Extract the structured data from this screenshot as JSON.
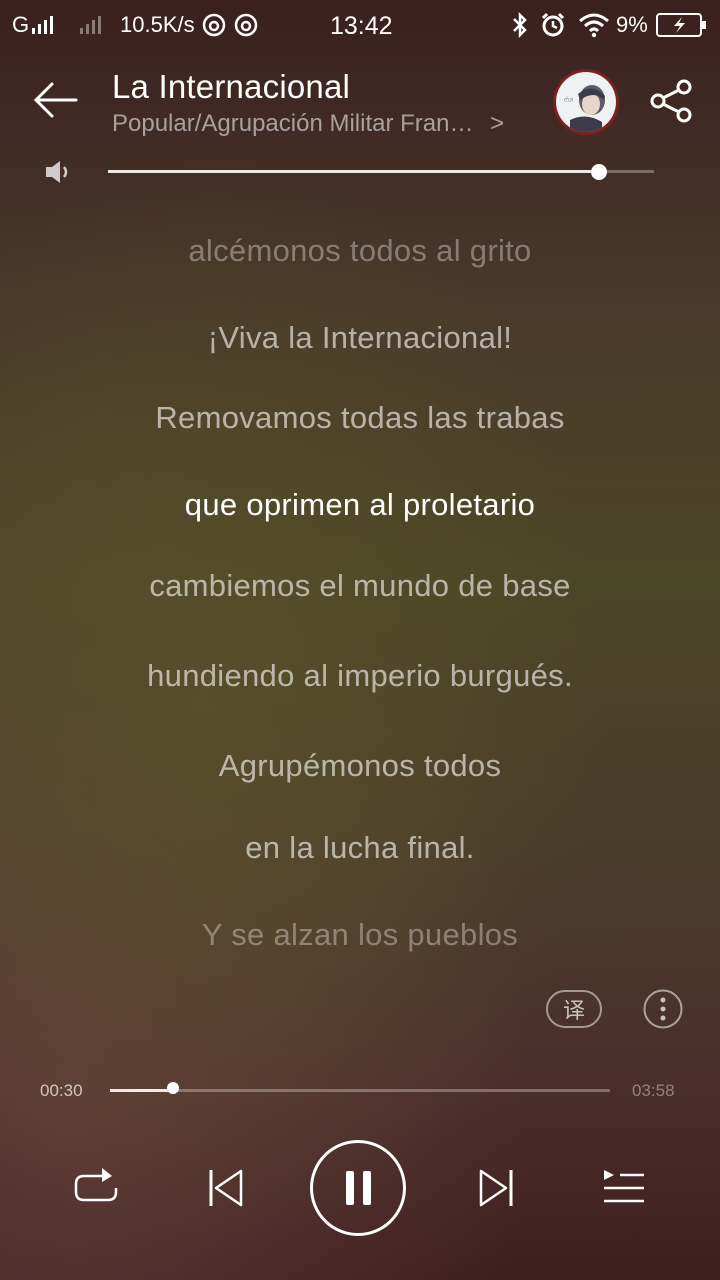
{
  "status_bar": {
    "network": "G",
    "speed": "10.5K/s",
    "time": "13:42",
    "battery": "9%"
  },
  "header": {
    "title": "La Internacional",
    "subtitle": "Popular/Agrupación Militar Fran…",
    "avatar_icon": "avatar-photo",
    "share_icon": "share-icon"
  },
  "volume": {
    "level": 0.9
  },
  "lyrics": [
    "alcémonos todos al grito",
    "¡Viva la Internacional!",
    "Removamos todas las trabas",
    "que oprimen al proletario",
    "cambiemos el mundo de base",
    "hundiendo al imperio burgués.",
    "Agrupémonos todos",
    "en la lucha final.",
    "Y se alzan los pueblos"
  ],
  "active_lyric_index": 3,
  "extras": {
    "translate_label": "译"
  },
  "playback": {
    "elapsed": "00:30",
    "total": "03:58",
    "progress": 0.126
  },
  "colors": {
    "accent": "#ffffff",
    "avatar_ring": "#962020"
  }
}
